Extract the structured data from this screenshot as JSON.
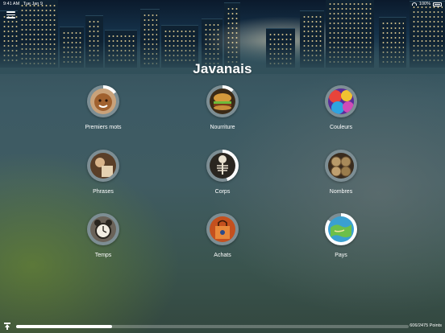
{
  "status_bar": {
    "time": "9:41 AM",
    "date": "Tue Jan 9",
    "battery": "100%"
  },
  "header": {
    "title": "Javanais",
    "menu_icon": "hamburger-menu-icon"
  },
  "categories": [
    {
      "label": "Premiers mots",
      "icon": "baby-face-icon",
      "progress": 0.15
    },
    {
      "label": "Nourriture",
      "icon": "burger-icon",
      "progress": 0.12
    },
    {
      "label": "Couleurs",
      "icon": "color-paint-icon",
      "progress": 0.0
    },
    {
      "label": "Phrases",
      "icon": "conversation-icon",
      "progress": 0.0
    },
    {
      "label": "Corps",
      "icon": "skeleton-icon",
      "progress": 0.45
    },
    {
      "label": "Nombres",
      "icon": "coins-icon",
      "progress": 0.0
    },
    {
      "label": "Temps",
      "icon": "clock-icon",
      "progress": 0.0
    },
    {
      "label": "Achats",
      "icon": "shopping-icon",
      "progress": 0.0
    },
    {
      "label": "Pays",
      "icon": "globe-map-icon",
      "progress": 0.85
    }
  ],
  "footer": {
    "points_text": "606/2475 Points",
    "progress": 0.245
  },
  "colors": {
    "accent": "#ffffff",
    "ring_track": "#7d8e94"
  }
}
